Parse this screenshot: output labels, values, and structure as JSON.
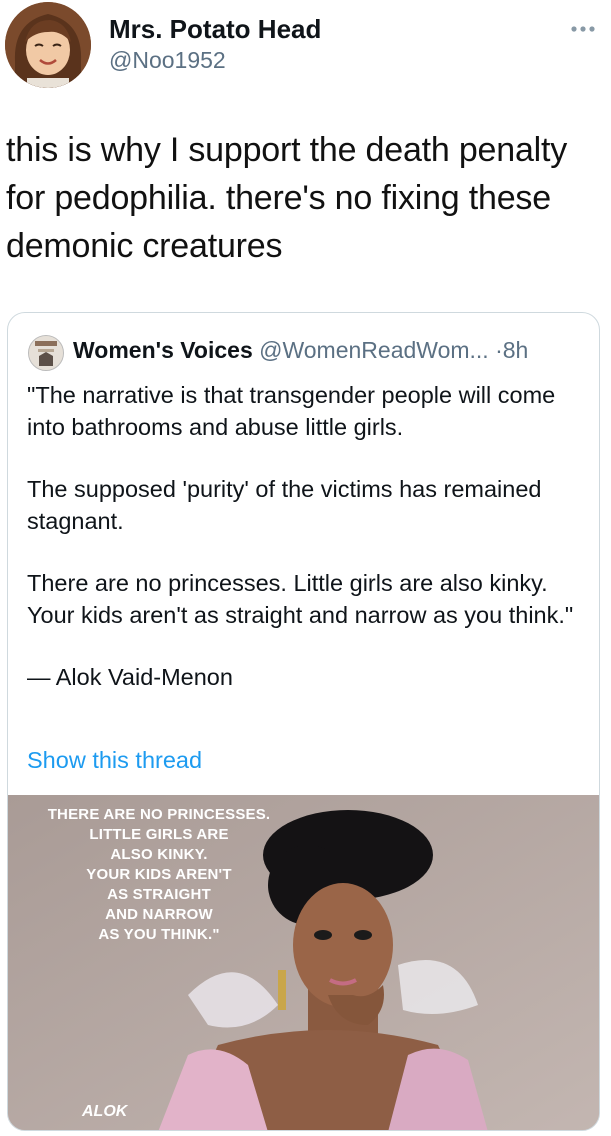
{
  "author": {
    "display_name": "Mrs. Potato Head",
    "handle": "@Noo1952",
    "avatar_icon": "bitmoji-avatar-icon",
    "menu_icon": "more-dots-icon"
  },
  "tweet": {
    "lines": [
      "this is why I support the death penalty",
      "for pedophilia.  there's no fixing these",
      "demonic creatures"
    ]
  },
  "quoted": {
    "display_name": "Women's Voices",
    "handle": "@WomenReadWom...",
    "separator": "·",
    "time": "8h",
    "avatar_icon": "womens-voices-logo-icon",
    "paragraphs": [
      "\"The narrative is that transgender people will come into bathrooms and abuse little girls.",
      "The supposed 'purity' of the victims has remained stagnant.",
      "There are no princesses. Little girls are also kinky. Your kids aren't as straight and narrow as you think.\"",
      "— Alok Vaid-Menon"
    ],
    "show_thread": "Show this thread",
    "image": {
      "overlay_lines": [
        "THERE ARE NO PRINCESSES.",
        "LITTLE GIRLS ARE",
        "ALSO KINKY.",
        "YOUR KIDS AREN'T",
        "AS STRAIGHT",
        "AND NARROW",
        "AS YOU THINK.\""
      ],
      "signature": "ALOK"
    }
  },
  "colors": {
    "link": "#1d9bf0",
    "secondary_text": "#5b7083",
    "border": "#cfd9de"
  }
}
